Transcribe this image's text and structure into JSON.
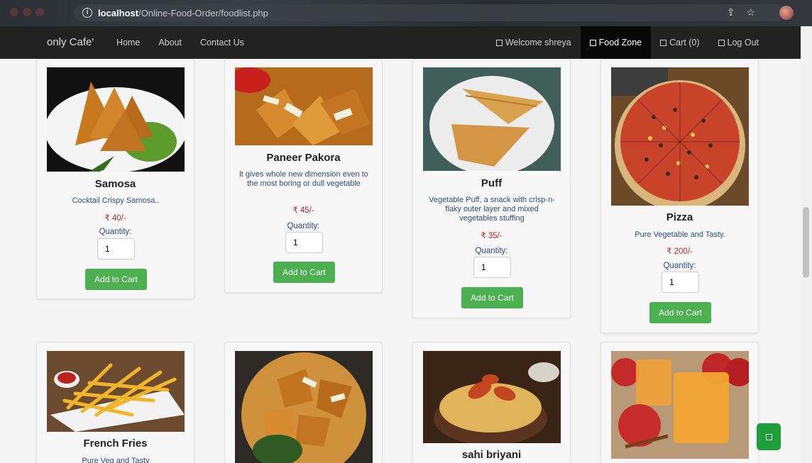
{
  "browser": {
    "url_host": "localhost",
    "url_path": "/Online-Food-Order/foodlist.php"
  },
  "nav": {
    "brand": "only Cafe'",
    "home": "Home",
    "about": "About",
    "contact": "Contact Us",
    "welcome": "Welcome shreya",
    "food_zone": "Food Zone",
    "cart": "Cart (0)",
    "logout": "Log Out"
  },
  "quantity_label": "Quantity:",
  "add_label": "Add to Cart",
  "items": [
    {
      "name": "Samosa",
      "desc": "Cocktail Crispy Samosa..",
      "price": "₹ 40/-",
      "qty": "1"
    },
    {
      "name": "Paneer Pakora",
      "desc": "it gives whole new dimension even to the most boring or dull vegetable",
      "price": "₹ 45/-",
      "qty": "1"
    },
    {
      "name": "Puff",
      "desc": "Vegetable Puff, a snack with crisp-n-flaky outer layer and mixed vegetables stuffing",
      "price": "₹ 35/-",
      "qty": "1"
    },
    {
      "name": "Pizza",
      "desc": "Pure Vegetable and Tasty.",
      "price": "₹ 200/-",
      "qty": "1"
    },
    {
      "name": "French Fries",
      "desc": "Pure Veg and Tasty"
    },
    {
      "name": "",
      "desc": ""
    },
    {
      "name": "sahi briyani",
      "desc": ""
    },
    {
      "name": "",
      "desc": ""
    }
  ],
  "colors": {
    "navbar": "#222222",
    "button": "#4caf50",
    "price": "#c62828",
    "desc": "#2d4f85"
  }
}
